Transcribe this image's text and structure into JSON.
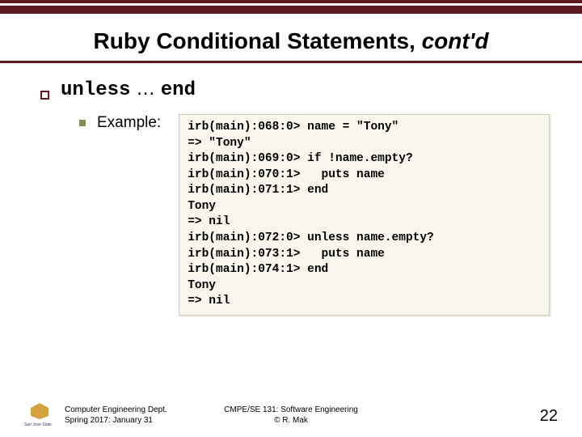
{
  "title": {
    "main": "Ruby Conditional Statements, ",
    "italic": "cont'd"
  },
  "heading": {
    "kw1": "unless",
    "mid": " … ",
    "kw2": "end"
  },
  "example_label": "Example:",
  "code": "irb(main):068:0> name = \"Tony\"\n=> \"Tony\"\nirb(main):069:0> if !name.empty?\nirb(main):070:1>   puts name\nirb(main):071:1> end\nTony\n=> nil\nirb(main):072:0> unless name.empty?\nirb(main):073:1>   puts name\nirb(main):074:1> end\nTony\n=> nil",
  "footer": {
    "left_line1": "Computer Engineering Dept.",
    "left_line2": "Spring 2017: January 31",
    "center_line1": "CMPE/SE 131: Software Engineering",
    "center_line2": "© R. Mak",
    "page": "22",
    "logo_text": "San Jose State"
  }
}
